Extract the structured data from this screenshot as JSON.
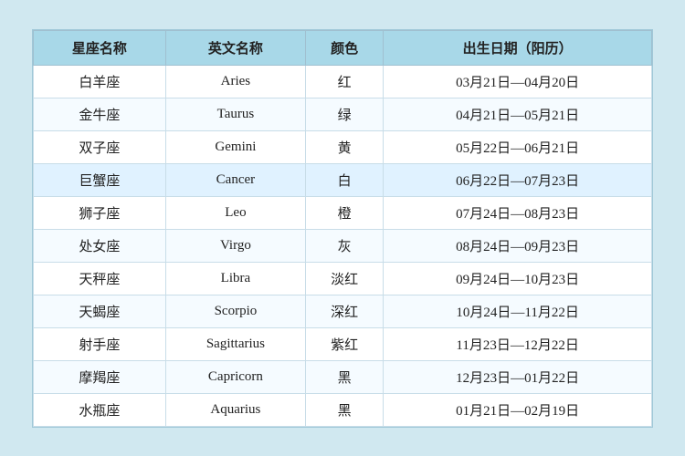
{
  "table": {
    "headers": [
      "星座名称",
      "英文名称",
      "颜色",
      "出生日期（阳历）"
    ],
    "rows": [
      {
        "cn": "白羊座",
        "en": "Aries",
        "color": "红",
        "dates": "03月21日—04月20日",
        "highlight": false
      },
      {
        "cn": "金牛座",
        "en": "Taurus",
        "color": "绿",
        "dates": "04月21日—05月21日",
        "highlight": false
      },
      {
        "cn": "双子座",
        "en": "Gemini",
        "color": "黄",
        "dates": "05月22日—06月21日",
        "highlight": false
      },
      {
        "cn": "巨蟹座",
        "en": "Cancer",
        "color": "白",
        "dates": "06月22日—07月23日",
        "highlight": true
      },
      {
        "cn": "狮子座",
        "en": "Leo",
        "color": "橙",
        "dates": "07月24日—08月23日",
        "highlight": false
      },
      {
        "cn": "处女座",
        "en": "Virgo",
        "color": "灰",
        "dates": "08月24日—09月23日",
        "highlight": false
      },
      {
        "cn": "天秤座",
        "en": "Libra",
        "color": "淡红",
        "dates": "09月24日—10月23日",
        "highlight": false
      },
      {
        "cn": "天蝎座",
        "en": "Scorpio",
        "color": "深红",
        "dates": "10月24日—11月22日",
        "highlight": false
      },
      {
        "cn": "射手座",
        "en": "Sagittarius",
        "color": "紫红",
        "dates": "11月23日—12月22日",
        "highlight": false
      },
      {
        "cn": "摩羯座",
        "en": "Capricorn",
        "color": "黑",
        "dates": "12月23日—01月22日",
        "highlight": false
      },
      {
        "cn": "水瓶座",
        "en": "Aquarius",
        "color": "黑",
        "dates": "01月21日—02月19日",
        "highlight": false
      }
    ]
  }
}
